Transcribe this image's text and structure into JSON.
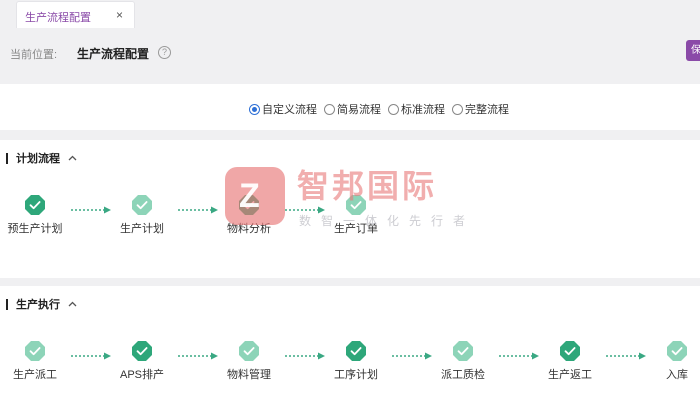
{
  "tab": {
    "label": "生产流程配置",
    "close": "×"
  },
  "breadcrumb": {
    "prefix": "当前位置:",
    "page": "生产流程配置",
    "help": "?"
  },
  "edge_button": {
    "label": "保"
  },
  "flow_type": {
    "options": [
      "自定义流程",
      "简易流程",
      "标准流程",
      "完整流程"
    ],
    "selected": "自定义流程"
  },
  "sections": [
    {
      "title": "计划流程",
      "steps": [
        {
          "label": "预生产计划",
          "state": "done"
        },
        {
          "label": "生产计划",
          "state": "light"
        },
        {
          "label": "物料分析",
          "state": "done"
        },
        {
          "label": "生产订单",
          "state": "light"
        }
      ]
    },
    {
      "title": "生产执行",
      "steps": [
        {
          "label": "生产派工",
          "state": "light"
        },
        {
          "label": "APS排产",
          "state": "done"
        },
        {
          "label": "物料管理",
          "state": "light"
        },
        {
          "label": "工序计划",
          "state": "done"
        },
        {
          "label": "派工质检",
          "state": "light"
        },
        {
          "label": "生产返工",
          "state": "done"
        },
        {
          "label": "入库",
          "state": "light"
        }
      ]
    }
  ],
  "watermark": {
    "logo": "Z",
    "title": "智邦国际",
    "subtitle": "数智一体化先行者"
  },
  "colors": {
    "done": "#2ea77a",
    "light": "#8dd4b8",
    "arrow": "#3aa883",
    "accent": "#8a4aa8",
    "radio": "#2d6fd6"
  },
  "icons": {
    "step": "check-badge-icon",
    "section_toggle": "chevron-up-icon",
    "help": "question-circle-icon",
    "tab_close": "close-icon"
  }
}
